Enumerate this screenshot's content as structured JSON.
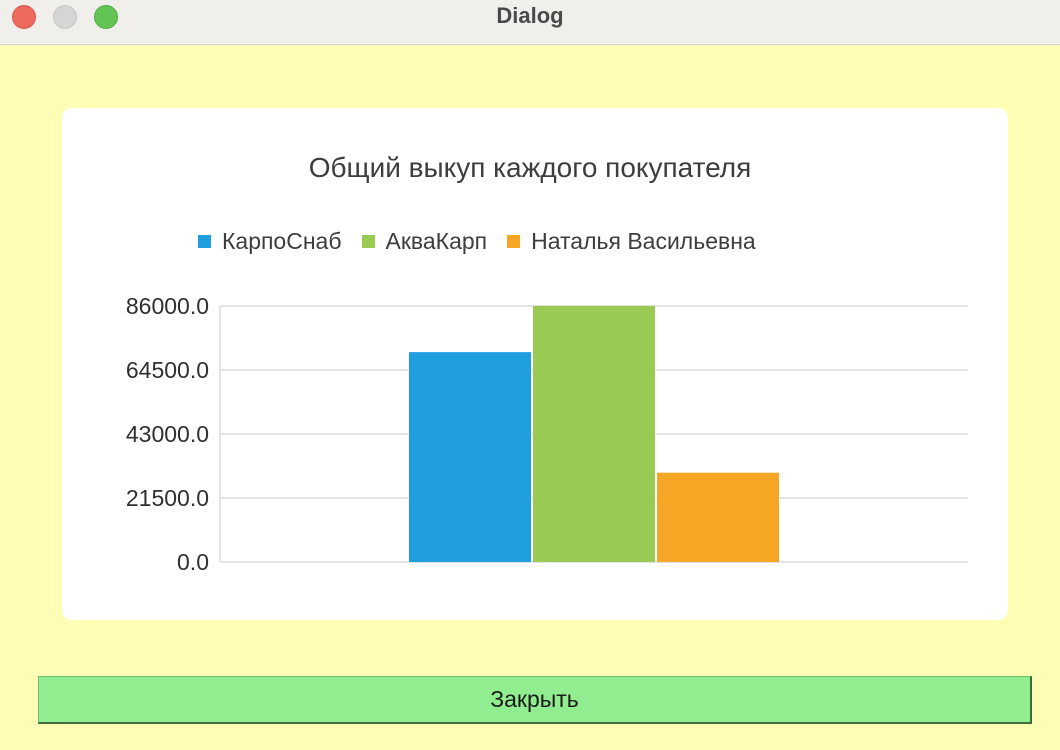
{
  "window": {
    "title": "Dialog"
  },
  "chart_data": {
    "type": "bar",
    "title": "Общий выкуп каждого покупателя",
    "xlabel": "",
    "ylabel": "",
    "categories": [
      ""
    ],
    "series": [
      {
        "name": "КарпоСнаб",
        "values": [
          70500
        ],
        "color": "#209fdf"
      },
      {
        "name": "АкваКарп",
        "values": [
          86000
        ],
        "color": "#99ca53"
      },
      {
        "name": "Наталья Васильевна",
        "values": [
          30000
        ],
        "color": "#f6a625"
      }
    ],
    "ylim": [
      0,
      86000
    ],
    "yticks": [
      "0.0",
      "21500.0",
      "43000.0",
      "64500.0",
      "86000.0"
    ],
    "grid": true,
    "legend_position": "top"
  },
  "footer": {
    "close_label": "Закрыть"
  },
  "colors": {
    "background": "#fffdb5",
    "button": "#90ee90"
  }
}
